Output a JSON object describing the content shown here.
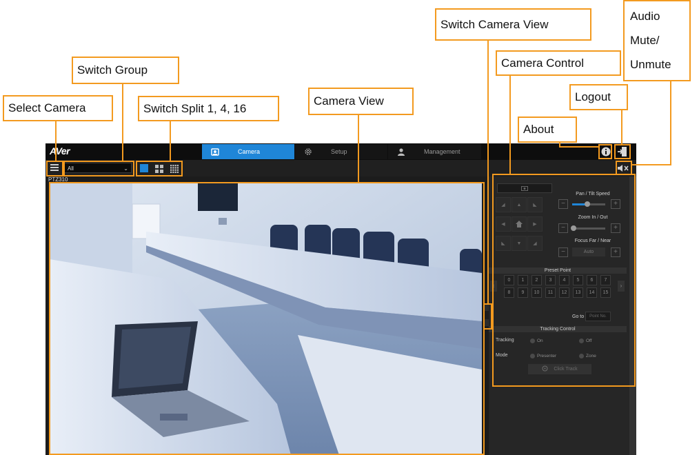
{
  "app": {
    "logo": "AVer",
    "tabs": [
      {
        "label": "Camera",
        "icon": "camera-icon",
        "active": true
      },
      {
        "label": "Setup",
        "icon": "gear-icon",
        "active": false
      },
      {
        "label": "Management",
        "icon": "user-icon",
        "active": false
      }
    ],
    "group_select": {
      "value": "All"
    },
    "camera_label": "PTZ310"
  },
  "control": {
    "pan_tilt_speed": "Pan / Tilt Speed",
    "pan_tilt_level": 0.45,
    "zoom": "Zoom In / Out",
    "zoom_level": 0.05,
    "focus": "Focus Far / Near",
    "focus_mode": "Auto",
    "preset_header": "Preset Point",
    "presets_row1": [
      "0",
      "1",
      "2",
      "3",
      "4",
      "5",
      "6",
      "7"
    ],
    "presets_row2": [
      "8",
      "9",
      "10",
      "11",
      "12",
      "13",
      "14",
      "15"
    ],
    "goto_label": "Go to",
    "goto_placeholder": "Point No.",
    "tracking_header": "Tracking Control",
    "tracking_label": "Tracking",
    "tracking_on": "On",
    "tracking_off": "Off",
    "mode_label": "Mode",
    "mode_presenter": "Presenter",
    "mode_zone": "Zone",
    "click_track": "Click Track"
  },
  "annotations": {
    "select_camera": "Select Camera",
    "switch_group": "Switch Group",
    "switch_split": "Switch Split 1, 4, 16",
    "camera_view": "Camera View",
    "switch_camera_view": "Switch Camera View",
    "camera_control": "Camera Control",
    "about": "About",
    "logout": "Logout",
    "audio_line1": "Audio",
    "audio_line2": "Mute/",
    "audio_line3": "Unmute"
  },
  "colors": {
    "accent": "#1f86d8",
    "annotation": "#f39a1f",
    "background": "#1c1c1c"
  }
}
